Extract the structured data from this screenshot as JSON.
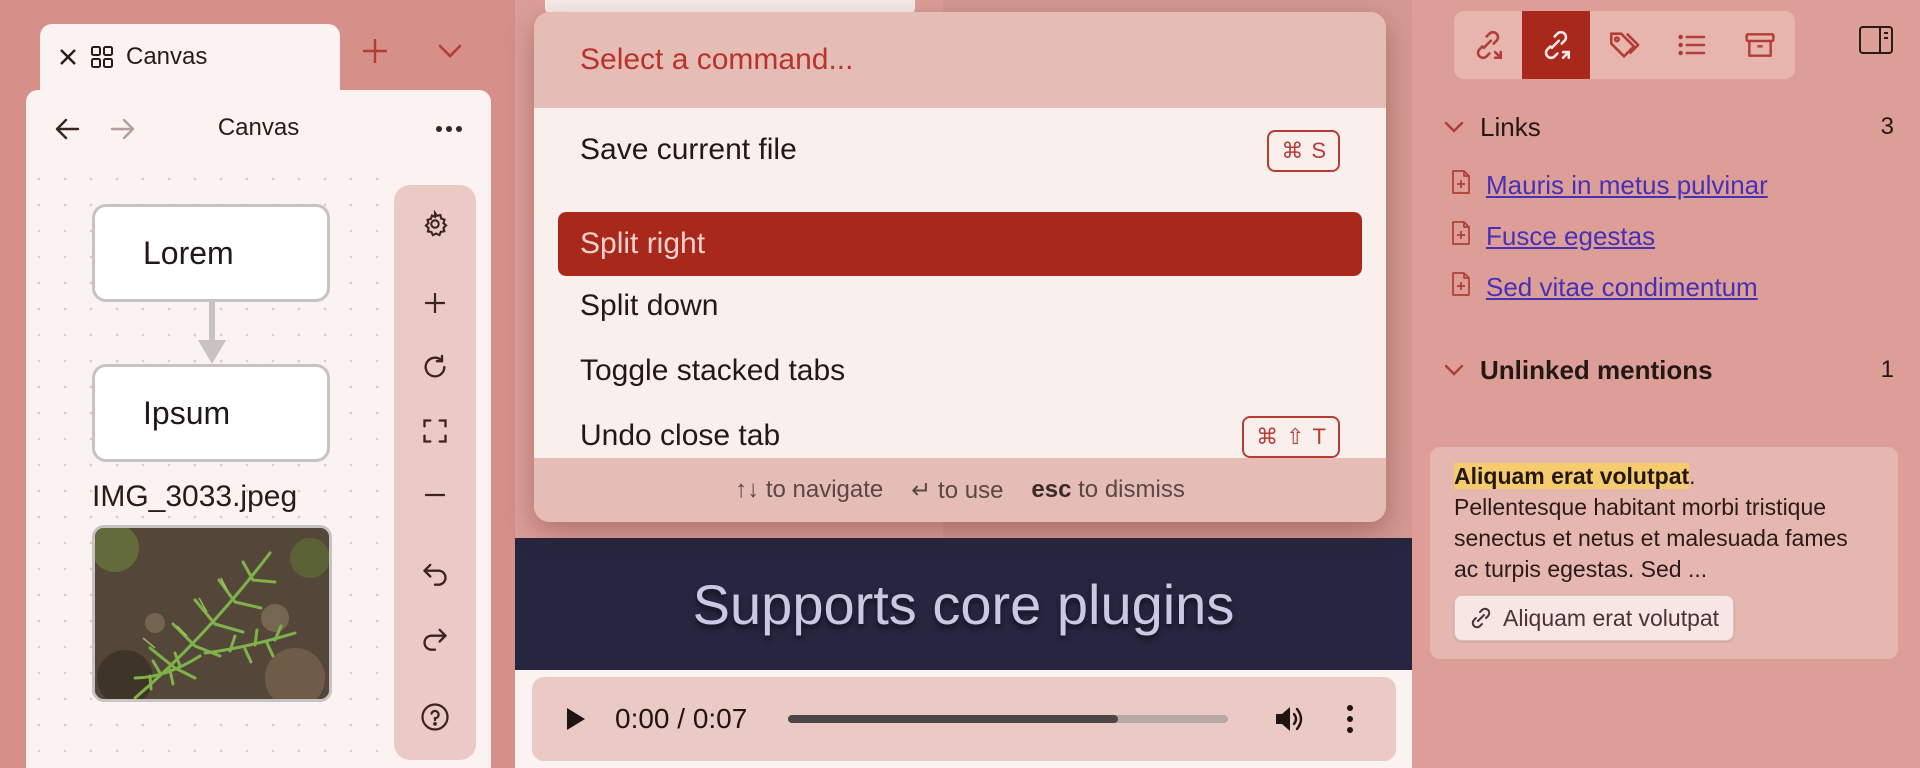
{
  "left": {
    "tab": {
      "close_icon": "close-icon",
      "grid_icon": "grid-icon",
      "title": "Canvas"
    },
    "new_tab_icon": "plus-icon",
    "tab_list_icon": "chevron-down-icon",
    "view": {
      "title": "Canvas",
      "back_icon": "arrow-left-icon",
      "forward_icon": "arrow-right-icon",
      "more_icon": "more-horizontal-icon"
    },
    "canvas": {
      "nodes": [
        "Lorem",
        "Ipsum"
      ],
      "image_title": "IMG_3033.jpeg"
    },
    "controls": [
      "settings",
      "zoom-in",
      "reset",
      "fit",
      "zoom-out",
      "undo",
      "redo",
      "help"
    ]
  },
  "palette": {
    "placeholder": "Select a command...",
    "commands": [
      {
        "label": "Save current file",
        "hotkey": [
          "⌘",
          "S"
        ]
      },
      {
        "label": "Split right",
        "selected": true
      },
      {
        "label": "Split down"
      },
      {
        "label": "Toggle stacked tabs"
      },
      {
        "label": "Undo close tab",
        "hotkey": [
          "⌘",
          "⇧",
          "T"
        ]
      }
    ],
    "footer": {
      "navigate_keys": "↑↓",
      "navigate_text": "to navigate",
      "use_key": "↵",
      "use_text": "to use",
      "dismiss_key": "esc",
      "dismiss_text": "to dismiss"
    }
  },
  "middle": {
    "banner": "Supports core plugins",
    "audio": {
      "time": "0:00 / 0:07",
      "progress": 0.75
    }
  },
  "right": {
    "toolbar": [
      "backlinks",
      "outgoing-links",
      "tags",
      "outline",
      "archive"
    ],
    "links": {
      "title": "Links",
      "count": "3",
      "items": [
        "Mauris in metus pulvinar",
        "Fusce egestas",
        "Sed vitae condimentum"
      ]
    },
    "unlinked": {
      "title": "Unlinked mentions",
      "count": "1",
      "highlight": "Aliquam erat volutpat",
      "after_highlight": ".",
      "body": "Pellentesque habitant morbi tristique senectus et netus et malesuada fames ac turpis egestas. Sed ...",
      "link_label": "Aliquam erat volutpat"
    }
  },
  "colors": {
    "accent": "#a8281b",
    "link": "#4730b8",
    "banner_bg": "#262641"
  }
}
